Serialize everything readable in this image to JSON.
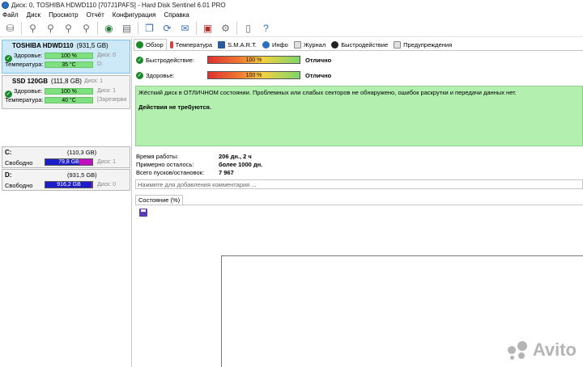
{
  "window": {
    "title": "Диск: 0, TOSHIBA HDWD110 [707J1PAFS]  -  Hard Disk Sentinel 6.01 PRO"
  },
  "menu": [
    "Файл",
    "Диск",
    "Просмотр",
    "Отчёт",
    "Конфигурация",
    "Справка"
  ],
  "disks": [
    {
      "name": "TOSHIBA HDWD110",
      "size": "(931,5 GB)",
      "health_label": "Здоровье:",
      "health": "100 %",
      "health_side": "Диск: 0",
      "temp_label": "Температура:",
      "temp": "35 °C",
      "temp_side": "D:"
    },
    {
      "name": "SSD 120GB",
      "size": "(111,8 GB)",
      "size_side": "Диск: 1",
      "health_label": "Здоровье:",
      "health": "100 %",
      "health_side": "Диск: 1",
      "temp_label": "Температура:",
      "temp": "40 °C",
      "temp_side": "[Зарезерви"
    }
  ],
  "partitions": [
    {
      "name": "C:",
      "size": "(110,3 GB)",
      "free_label": "Свободно",
      "free": "79,8 GB",
      "free_fraction": 0.72,
      "side": "Диск: 1"
    },
    {
      "name": "D:",
      "size": "(931,5 GB)",
      "free_label": "Свободно",
      "free": "916,2 GB",
      "free_fraction": 0.98,
      "side": "Диск: 0"
    }
  ],
  "tabs": [
    "Обзор",
    "Температура",
    "S.M.A.R.T.",
    "Инфо",
    "Журнал",
    "Быстродействие",
    "Предупреждения"
  ],
  "overview": {
    "performance_label": "Быстродействие:",
    "performance_value": "100 %",
    "performance_status": "Отлично",
    "health_label": "Здоровье:",
    "health_value": "100 %",
    "health_status": "Отлично",
    "message": "Жёсткий диск в ОТЛИЧНОМ состоянии. Проблемных или слабых секторов не обнаружено, ошибок раскрутки и передачи данных нет.",
    "action": "Действия не требуются.",
    "uptime_label": "Время работы:",
    "uptime_value": "206 дн., 2 ч",
    "remaining_label": "Примерно осталось:",
    "remaining_value": "более 1000 дн.",
    "starts_label": "Всего пусков/остановок:",
    "starts_value": "7 967",
    "comment_placeholder": "Нажмите для добавления комментария ...",
    "state_tab": "Состояние (%)"
  },
  "watermark": "Avito",
  "colors": {
    "selected_card": "#cde8f7",
    "status_green": "#b3f0b0",
    "free_space_blue": "#1c1cc8",
    "used_space_magenta": "#c010c0"
  }
}
